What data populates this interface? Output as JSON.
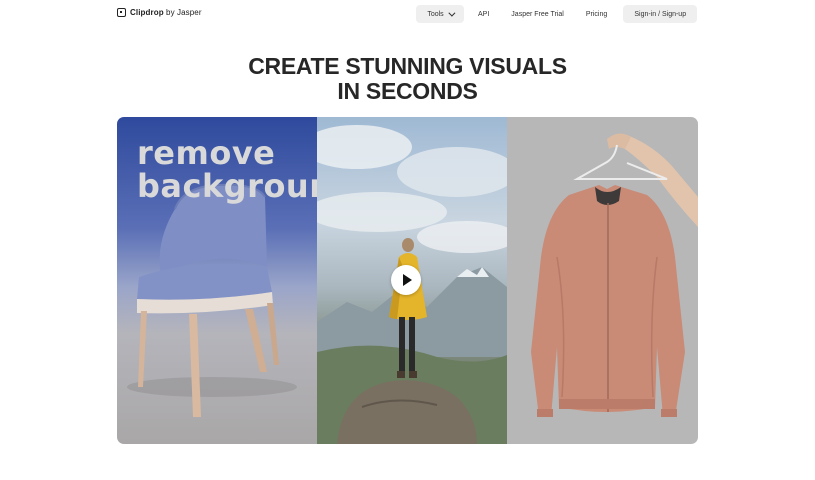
{
  "logo": {
    "brand": "Clipdrop",
    "suffix": "by Jasper"
  },
  "nav": {
    "tools": "Tools",
    "api": "API",
    "trial": "Jasper Free Trial",
    "pricing": "Pricing",
    "signin": "Sign-in / Sign-up"
  },
  "headline": {
    "line1": "CREATE STUNNING VISUALS",
    "line2": "IN SECONDS"
  },
  "hero": {
    "overlay_line1": "remove",
    "overlay_line2": "background"
  },
  "icons": {
    "logo": "clipdrop-logo-icon",
    "tools_chevron": "chevron-down-icon",
    "play": "play-icon"
  }
}
